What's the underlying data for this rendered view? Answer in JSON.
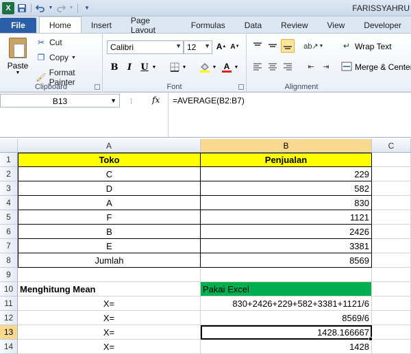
{
  "window": {
    "title": "FARISSYAHRU"
  },
  "qat": {
    "icons": [
      "excel-icon",
      "save-icon",
      "undo-icon",
      "redo-icon",
      "customize-icon"
    ]
  },
  "tabs": [
    {
      "label": "File"
    },
    {
      "label": "Home"
    },
    {
      "label": "Insert"
    },
    {
      "label": "Page Layout"
    },
    {
      "label": "Formulas"
    },
    {
      "label": "Data"
    },
    {
      "label": "Review"
    },
    {
      "label": "View"
    },
    {
      "label": "Developer"
    }
  ],
  "ribbon": {
    "clipboard": {
      "label": "Clipboard",
      "paste": "Paste",
      "cut": "Cut",
      "copy": "Copy",
      "format_painter": "Format Painter"
    },
    "font": {
      "label": "Font",
      "name": "Calibri",
      "size": "12",
      "bold": "B",
      "italic": "I",
      "underline": "U"
    },
    "alignment": {
      "label": "Alignment",
      "wrap_text": "Wrap Text",
      "merge_center": "Merge & Center"
    }
  },
  "formula_bar": {
    "name_box": "B13",
    "fx": "fx",
    "formula": "=AVERAGE(B2:B7)"
  },
  "sheet": {
    "columns": [
      "A",
      "B",
      "C"
    ],
    "rows": [
      {
        "n": "1",
        "a": "Toko",
        "b": "Penjualan"
      },
      {
        "n": "2",
        "a": "C",
        "b": "229"
      },
      {
        "n": "3",
        "a": "D",
        "b": "582"
      },
      {
        "n": "4",
        "a": "A",
        "b": "830"
      },
      {
        "n": "5",
        "a": "F",
        "b": "1121"
      },
      {
        "n": "6",
        "a": "B",
        "b": "2426"
      },
      {
        "n": "7",
        "a": "E",
        "b": "3381"
      },
      {
        "n": "8",
        "a": "Jumlah",
        "b": "8569"
      },
      {
        "n": "9",
        "a": "",
        "b": ""
      },
      {
        "n": "10",
        "a": "Menghitung Mean",
        "b": "Pakai Excel"
      },
      {
        "n": "11",
        "a": "X=",
        "b": "830+2426+229+582+3381+1121/6"
      },
      {
        "n": "12",
        "a": "X=",
        "b": "8569/6"
      },
      {
        "n": "13",
        "a": "X=",
        "b": "1428.166667"
      },
      {
        "n": "14",
        "a": "X=",
        "b": "1428"
      }
    ]
  },
  "colors": {
    "header_fill": "#ffff00",
    "excel_fill": "#00b050",
    "selection_header": "#f9d98f"
  }
}
